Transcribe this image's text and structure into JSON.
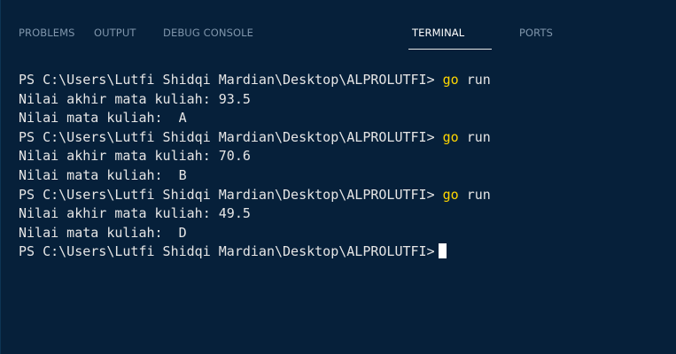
{
  "tabs": [
    {
      "label": "PROBLEMS",
      "active": false
    },
    {
      "label": "OUTPUT",
      "active": false
    },
    {
      "label": "DEBUG CONSOLE",
      "active": false
    },
    {
      "label": "TERMINAL",
      "active": true
    },
    {
      "label": "PORTS",
      "active": false
    }
  ],
  "terminal": {
    "lines": [
      {
        "type": "prompt",
        "prompt": "PS C:\\Users\\Lutfi Shidqi Mardian\\Desktop\\ALPROLUTFI> ",
        "command": "go",
        "args": " run"
      },
      {
        "type": "output",
        "text": "Nilai akhir mata kuliah: 93.5"
      },
      {
        "type": "output",
        "text": "Nilai mata kuliah:  A"
      },
      {
        "type": "prompt",
        "prompt": "PS C:\\Users\\Lutfi Shidqi Mardian\\Desktop\\ALPROLUTFI> ",
        "command": "go",
        "args": " run"
      },
      {
        "type": "output",
        "text": "Nilai akhir mata kuliah: 70.6"
      },
      {
        "type": "output",
        "text": "Nilai mata kuliah:  B"
      },
      {
        "type": "prompt",
        "prompt": "PS C:\\Users\\Lutfi Shidqi Mardian\\Desktop\\ALPROLUTFI> ",
        "command": "go",
        "args": " run"
      },
      {
        "type": "output",
        "text": "Nilai akhir mata kuliah: 49.5"
      },
      {
        "type": "output",
        "text": "Nilai mata kuliah:  D"
      },
      {
        "type": "prompt-current",
        "prompt": "PS C:\\Users\\Lutfi Shidqi Mardian\\Desktop\\ALPROLUTFI>"
      }
    ]
  },
  "colors": {
    "background": "#06203a",
    "text": "#e6e6e6",
    "command": "#ffd700",
    "tab_inactive": "#7f95ab",
    "tab_active": "#ffffff"
  }
}
